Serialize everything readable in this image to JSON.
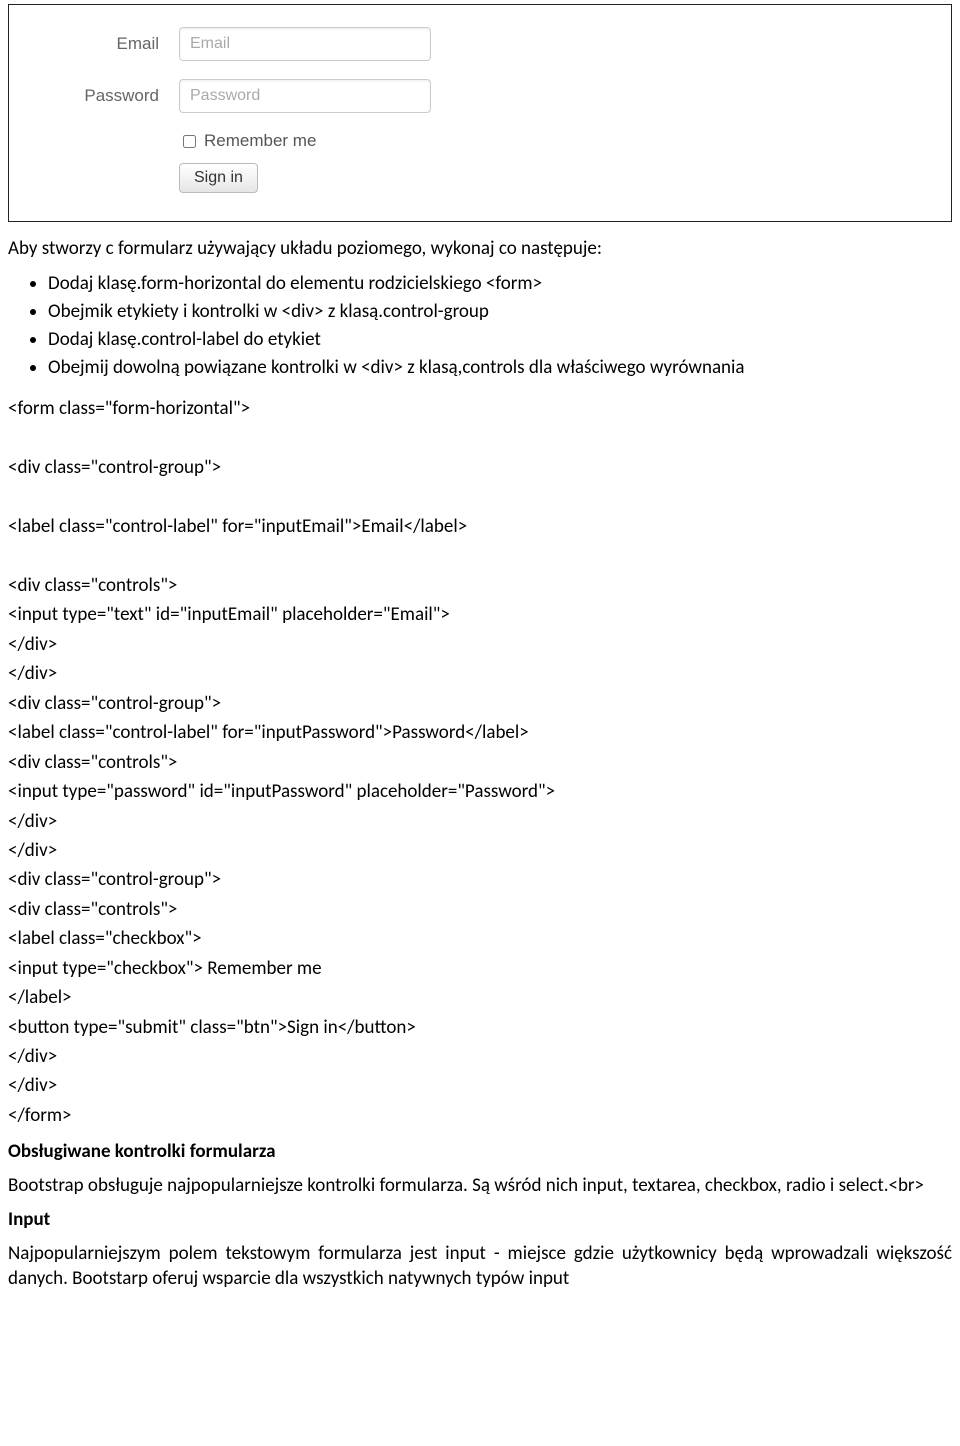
{
  "form_image": {
    "email_label": "Email",
    "email_placeholder": "Email",
    "password_label": "Password",
    "password_placeholder": "Password",
    "remember_label": " Remember me",
    "signin_label": "Sign in"
  },
  "intro": "Aby stworzy c formularz używający układu poziomego, wykonaj co następuje:",
  "bullets": [
    "Dodaj klasę.form-horizontal do elementu rodzicielskiego <form>",
    "Obejmik etykiety i kontrolki w <div> z klasą.control-group",
    "Dodaj klasę.control-label do etykiet",
    "Obejmij dowolną powiązane kontrolki w <div> z klasą,controls dla właściwego wyrównania"
  ],
  "code": "<form class=\"form-horizontal\">\n\n<div class=\"control-group\">\n\n<label class=\"control-label\" for=\"inputEmail\">Email</label>\n\n<div class=\"controls\">\n<input type=\"text\" id=\"inputEmail\" placeholder=\"Email\">\n</div>\n</div>\n<div class=\"control-group\">\n<label class=\"control-label\" for=\"inputPassword\">Password</label>\n<div class=\"controls\">\n<input type=\"password\" id=\"inputPassword\" placeholder=\"Password\">\n</div>\n</div>\n<div class=\"control-group\">\n<div class=\"controls\">\n<label class=\"checkbox\">\n<input type=\"checkbox\"> Remember me\n</label>\n<button type=\"submit\" class=\"btn\">Sign in</button>\n</div>\n</div>\n</form>",
  "section_heading": "Obsługiwane kontrolki formularza",
  "section_para": "Bootstrap obsługuje najpopularniejsze kontrolki formularza. Są wśród nich input, textarea, checkbox, radio i select.<br>",
  "input_heading": "Input",
  "input_para": "Najpopularniejszym polem tekstowym formularza jest input - miejsce gdzie użytkownicy będą wprowadzali większość  danych. Bootstarp oferuj wsparcie  dla wszystkich natywnych typów input"
}
